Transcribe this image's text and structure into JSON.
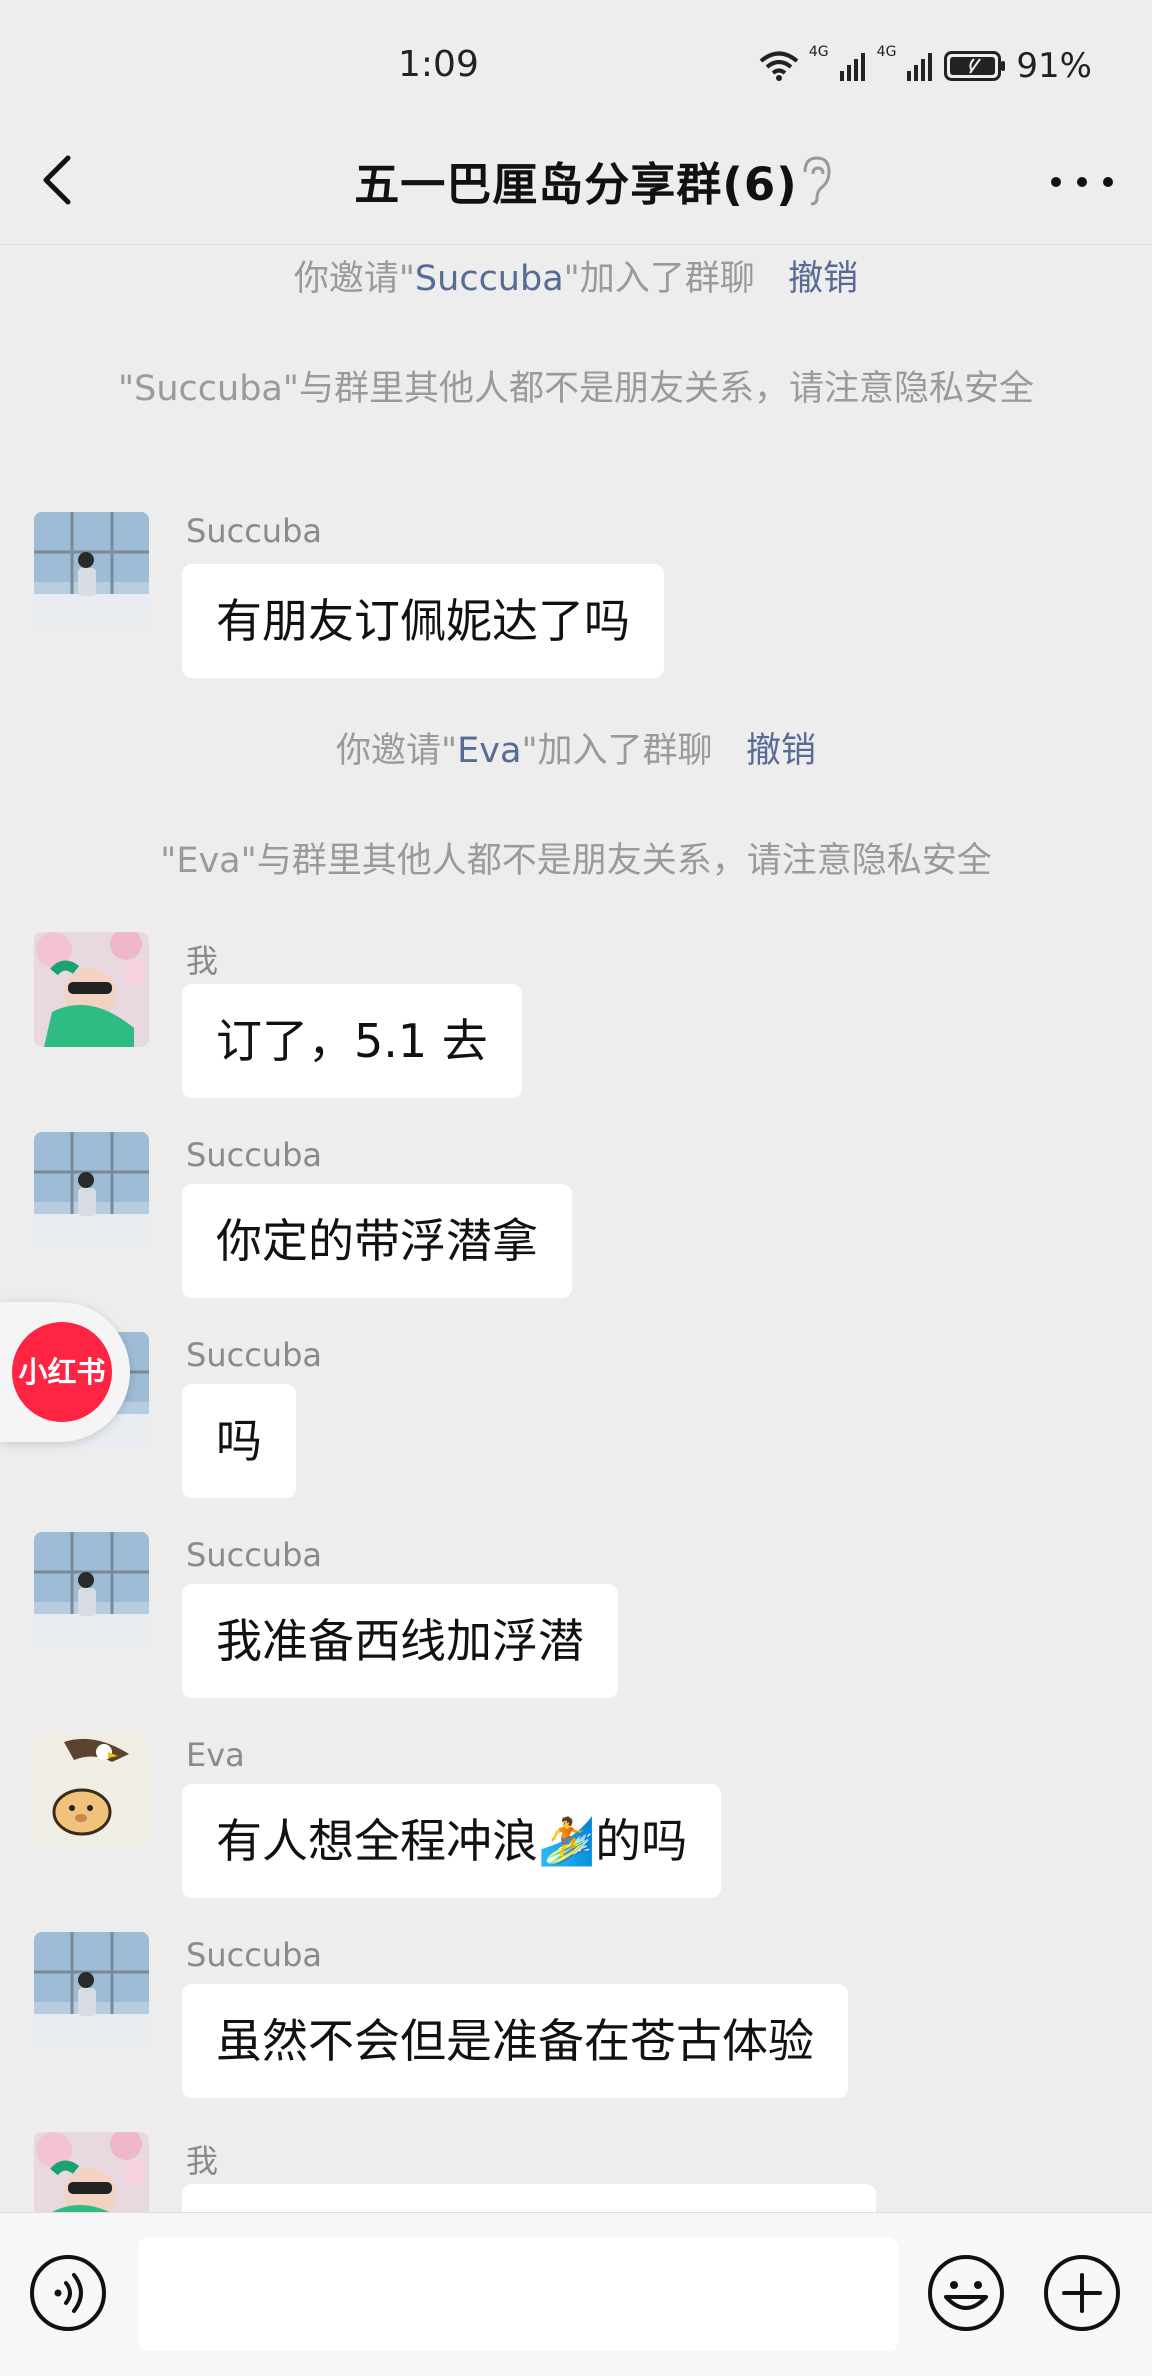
{
  "status": {
    "time": "1:09",
    "network1": "4G",
    "network2": "4G",
    "battery": "91%"
  },
  "header": {
    "title": "五一巴厘岛分享群(6)"
  },
  "messages": {
    "sys1_pre": "你邀请\"",
    "sys1_name": "Succuba",
    "sys1_post": "\"加入了群聊",
    "sys1_action": "撤销",
    "sys2": "\"Succuba\"与群里其他人都不是朋友关系，请注意隐私安全",
    "m1_sender": "Succuba",
    "m1_text": "有朋友订佩妮达了吗",
    "sys3_pre": "你邀请\"",
    "sys3_name": "Eva",
    "sys3_post": "\"加入了群聊",
    "sys3_action": "撤销",
    "sys4": "\"Eva\"与群里其他人都不是朋友关系，请注意隐私安全",
    "m2_sender": "我",
    "m2_text": "订了，5.1 去",
    "m3_sender": "Succuba",
    "m3_text": "你定的带浮潜拿",
    "m4_sender": "Succuba",
    "m4_text": "吗",
    "m5_sender": "Succuba",
    "m5_text": "我准备西线加浮潜",
    "m6_sender": "Eva",
    "m6_text_pre": "有人想全程冲浪",
    "m6_emoji": "🏄",
    "m6_text_post": "的吗",
    "m7_sender": "Succuba",
    "m7_text": "虽然不会但是准备在苍古体验",
    "m8_sender": "我"
  },
  "floating": {
    "xiaohongshu_label": "小红书"
  },
  "input": {
    "placeholder": ""
  },
  "colors": {
    "background": "#ededed",
    "bubble": "#ffffff",
    "link": "#576b95",
    "xhs_red": "#ff2442"
  },
  "icons": [
    "wifi-icon",
    "signal-icon",
    "battery-icon",
    "back-icon",
    "ear-icon",
    "more-icon",
    "voice-icon",
    "emoji-icon",
    "plus-icon"
  ]
}
